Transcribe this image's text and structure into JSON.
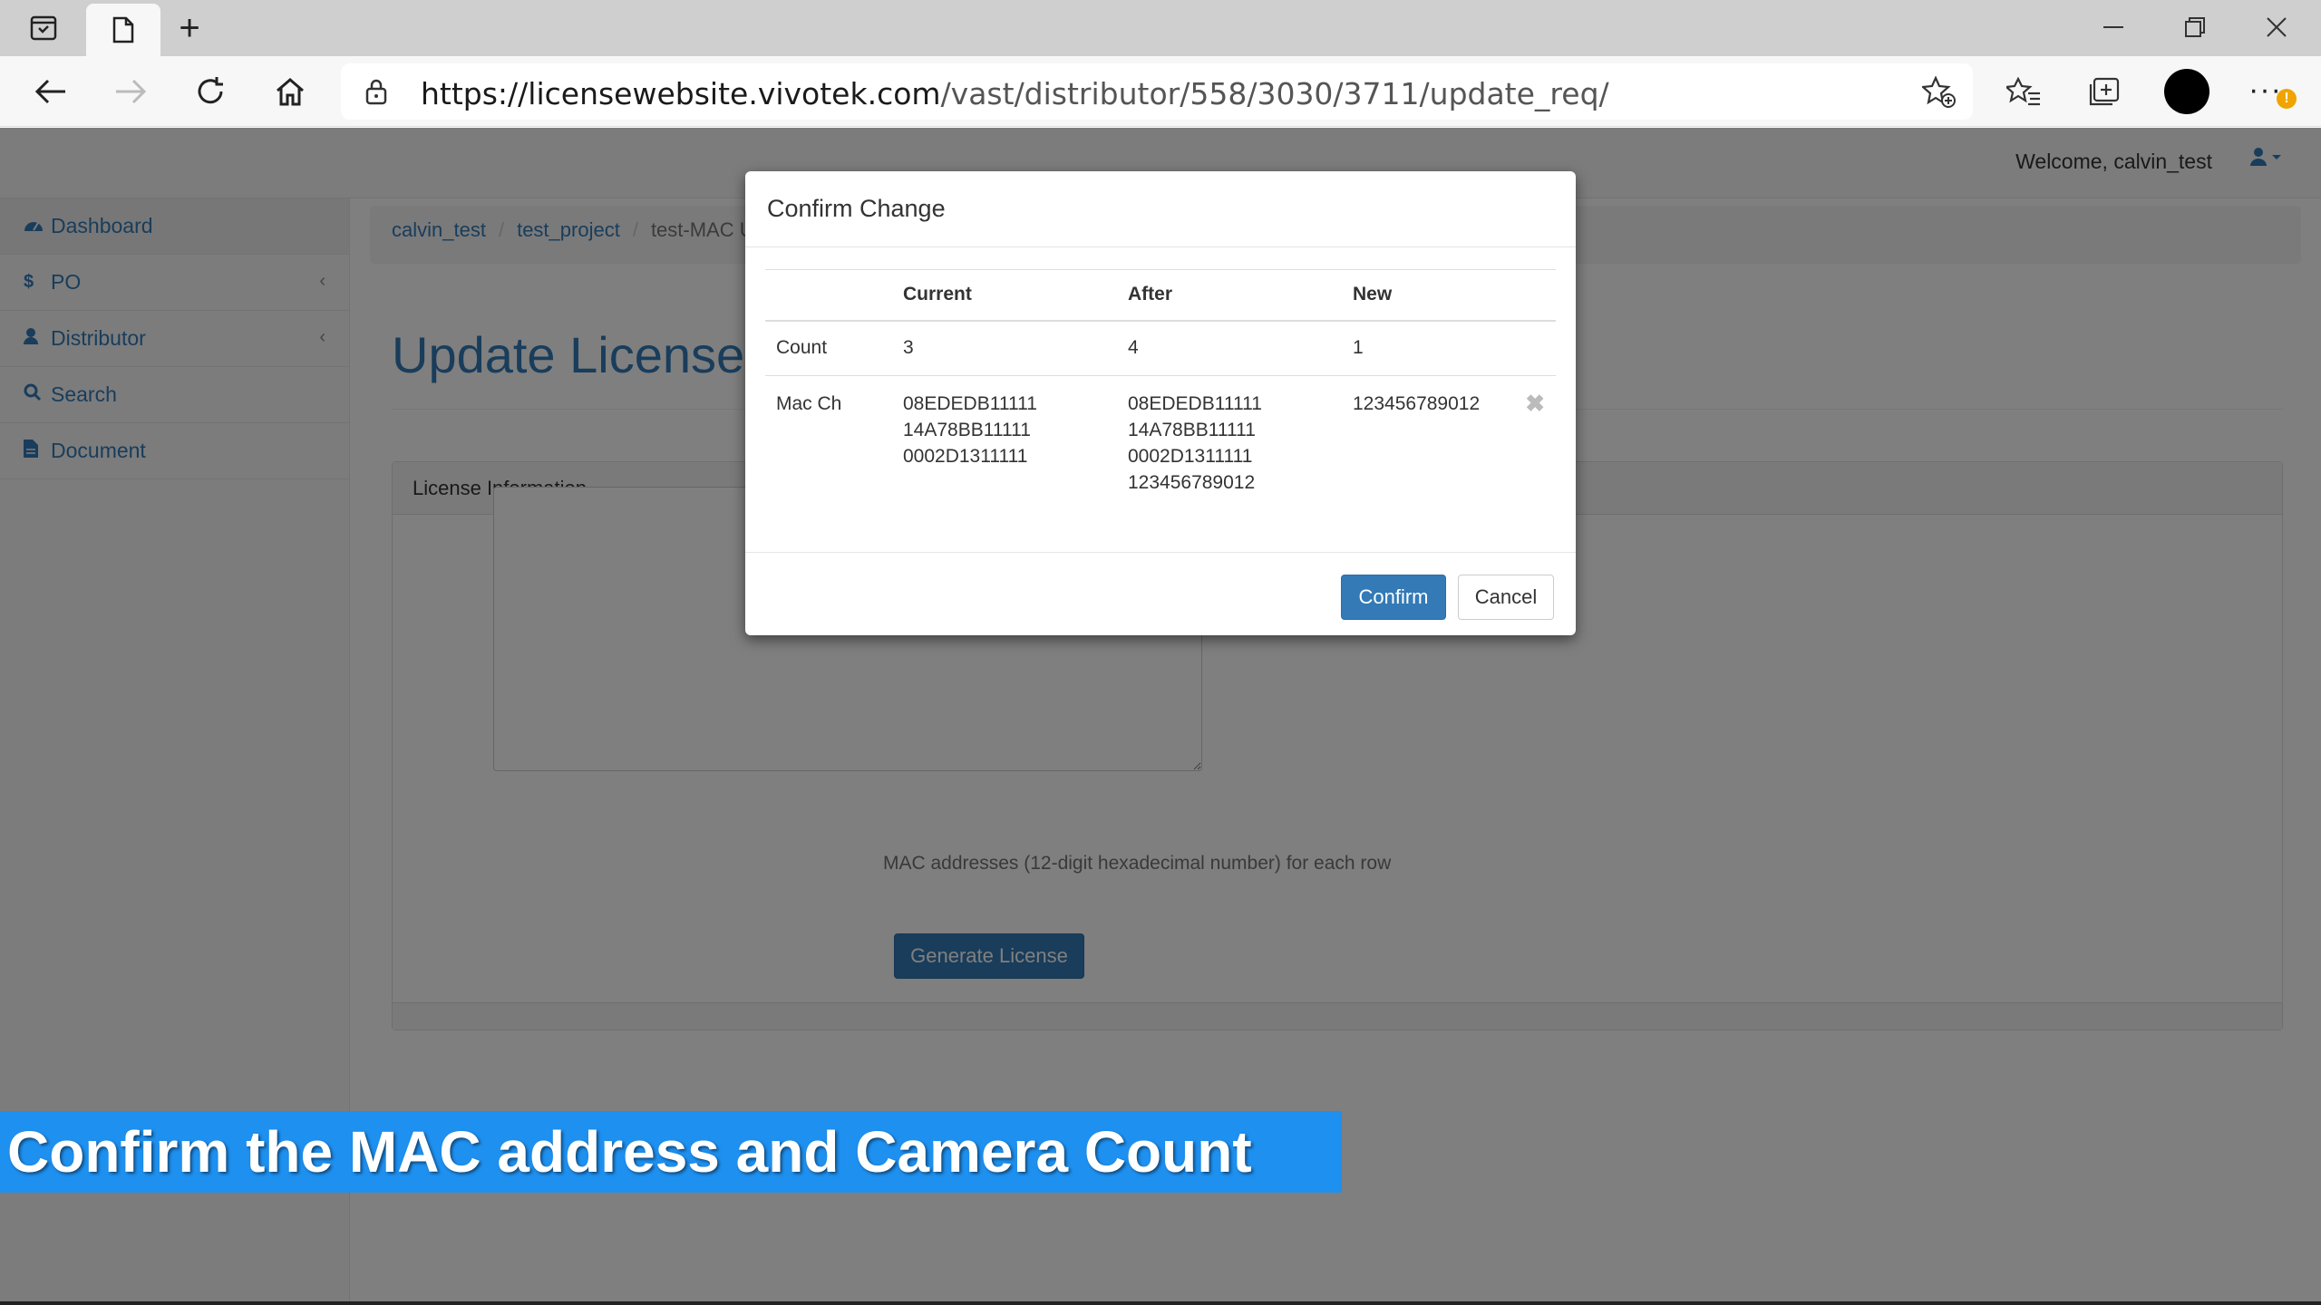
{
  "browser": {
    "url_host": "https://licensewebsite.vivotek.com",
    "url_path": "/vast/distributor/558/3030/3711/update_req/",
    "more_badge": "!"
  },
  "topnav": {
    "welcome": "Welcome, calvin_test"
  },
  "sidebar": {
    "items": [
      {
        "label": "Dashboard",
        "icon": "dashboard-icon"
      },
      {
        "label": "PO",
        "icon": "dollar-icon"
      },
      {
        "label": "Distributor",
        "icon": "user-icon"
      },
      {
        "label": "Search",
        "icon": "search-icon"
      },
      {
        "label": "Document",
        "icon": "file-icon"
      }
    ]
  },
  "breadcrumb": {
    "items": [
      "calvin_test",
      "test_project",
      "test-MAC U"
    ]
  },
  "page": {
    "title": "Update License",
    "panel_title": "License Information",
    "help_text": "MAC addresses (12-digit hexadecimal number) for each row",
    "generate_label": "Generate License"
  },
  "modal": {
    "title": "Confirm Change",
    "headers": [
      "",
      "Current",
      "After",
      "New"
    ],
    "count": {
      "label": "Count",
      "current": "3",
      "after": "4",
      "new": "1"
    },
    "mac": {
      "label": "Mac Ch",
      "current": [
        "08EDEDB11111",
        "14A78BB11111",
        "0002D1311111"
      ],
      "after": [
        "08EDEDB11111",
        "14A78BB11111",
        "0002D1311111",
        "123456789012"
      ],
      "new": [
        "123456789012"
      ]
    },
    "remove_symbol": "✖",
    "confirm_label": "Confirm",
    "cancel_label": "Cancel"
  },
  "caption": "Confirm the MAC address and Camera Count",
  "colors": {
    "accent": "#337ab7",
    "caption_bg": "#1e90f0"
  }
}
